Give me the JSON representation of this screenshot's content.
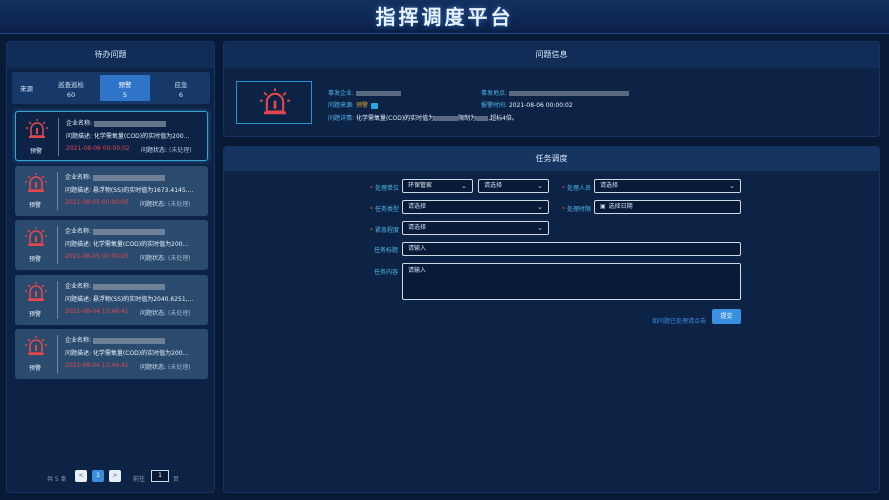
{
  "header": {
    "title": "指挥调度平台"
  },
  "todo": {
    "title": "待办问题",
    "source_label": "来源",
    "tabs": [
      {
        "label": "巡查巡检",
        "count": "60",
        "active": false
      },
      {
        "label": "预警",
        "count": "5",
        "active": true
      },
      {
        "label": "应急",
        "count": "6",
        "active": false
      }
    ],
    "cards": [
      {
        "warn_label": "预警",
        "company_label": "企业名称:",
        "desc": "问题描述: 化学需氧量(COD)的实时值为200...",
        "time": "2021-08-06 00:00:02",
        "status": "问题状态: ",
        "status_value": "(未处理)"
      },
      {
        "warn_label": "预警",
        "company_label": "企业名称:",
        "desc": "问题描述: 悬浮物(SS)的实时值为1673.4145,...",
        "time": "2021-08-05 00:00:05",
        "status": "问题状态: ",
        "status_value": "(未处理)"
      },
      {
        "warn_label": "预警",
        "company_label": "企业名称:",
        "desc": "问题描述: 化学需氧量(COD)的实时值为200...",
        "time": "2021-08-05 00:00:05",
        "status": "问题状态: ",
        "status_value": "(未处理)"
      },
      {
        "warn_label": "预警",
        "company_label": "企业名称:",
        "desc": "问题描述: 悬浮物(SS)的实时值为2040.6251,...",
        "time": "2021-08-04 12:46:41",
        "status": "问题状态: ",
        "status_value": "(未处理)"
      },
      {
        "warn_label": "预警",
        "company_label": "企业名称:",
        "desc": "问题描述: 化学需氧量(COD)的实时值为200...",
        "time": "2021-08-04 12:46:41",
        "status": "问题状态: ",
        "status_value": "(未处理)"
      }
    ],
    "pager": {
      "total": "共 5 条",
      "prev": "<",
      "page": "1",
      "next": ">",
      "goto_prefix": "前往",
      "goto_value": "1",
      "goto_suffix": "页"
    }
  },
  "info": {
    "title": "问题信息",
    "company_label": "事发企业:",
    "location_label": "事发地点:",
    "source_label": "问题来源:",
    "source_value": "预警",
    "time_label": "报警时间:",
    "time_value": "2021-08-06 00:00:02",
    "detail_label": "问题详情:",
    "detail_value_a": "化学需氧量(COD)的实时值为",
    "detail_value_b": "限制为",
    "detail_value_c": ",超标4倍。"
  },
  "task": {
    "title": "任务调度",
    "dept_label": "处理单位",
    "dept_value": "环保管家",
    "dept2_placeholder": "请选择",
    "person_label": "处理人员",
    "person_placeholder": "请选择",
    "type_label": "任务类型",
    "type_placeholder": "请选择",
    "deadline_label": "处理时限",
    "deadline_placeholder": "选择日期",
    "urgency_label": "紧急程度",
    "urgency_placeholder": "请选择",
    "task_title_label": "任务标题",
    "task_title_placeholder": "请输入",
    "task_content_label": "任务内容",
    "task_content_placeholder": "请输入",
    "help_link": "如问题已处理请点击",
    "submit_label": "提交"
  },
  "colors": {
    "accent": "#3a8fe0",
    "alarm": "#e0474c",
    "background": "#081a36"
  }
}
